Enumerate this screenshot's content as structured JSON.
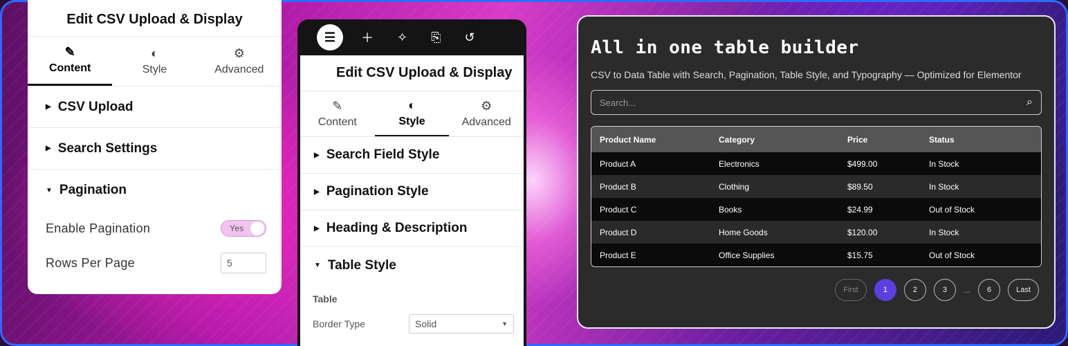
{
  "left_panel": {
    "title": "Edit CSV Upload & Display",
    "tabs": [
      {
        "label": "Content",
        "icon": "pencil-icon",
        "glyph": "✎"
      },
      {
        "label": "Style",
        "icon": "half-circle-icon",
        "glyph": "◐"
      },
      {
        "label": "Advanced",
        "icon": "gear-icon",
        "glyph": "⚙"
      }
    ],
    "sections": [
      "CSV Upload",
      "Search Settings",
      "Pagination"
    ],
    "enable_pagination_label": "Enable Pagination",
    "toggle_value": "Yes",
    "rows_per_page_label": "Rows Per Page",
    "rows_per_page_value": "5"
  },
  "middle_panel": {
    "title": "Edit CSV Upload & Display",
    "top_icons": [
      "elementor-logo-icon",
      "plus-icon",
      "sparkle-icon",
      "page-settings-icon",
      "history-icon"
    ],
    "tabs": [
      {
        "label": "Content",
        "icon": "pencil-icon",
        "glyph": "✎"
      },
      {
        "label": "Style",
        "icon": "half-circle-icon",
        "glyph": "◐"
      },
      {
        "label": "Advanced",
        "icon": "gear-icon",
        "glyph": "⚙"
      }
    ],
    "sections": [
      "Search Field Style",
      "Pagination Style",
      "Heading & Description",
      "Table Style"
    ],
    "sub_label": "Table",
    "border_type_label": "Border Type",
    "border_type_value": "Solid"
  },
  "right_panel": {
    "title": "All in one table builder",
    "description": "CSV to Data Table with Search, Pagination, Table Style, and Typography — Optimized for Elementor",
    "search_placeholder": "Search...",
    "table": {
      "headers": [
        "Product Name",
        "Category",
        "Price",
        "Status"
      ],
      "rows": [
        [
          "Product A",
          "Electronics",
          "$499.00",
          "In Stock"
        ],
        [
          "Product B",
          "Clothing",
          "$89.50",
          "In Stock"
        ],
        [
          "Product C",
          "Books",
          "$24.99",
          "Out of Stock"
        ],
        [
          "Product D",
          "Home Goods",
          "$120.00",
          "In Stock"
        ],
        [
          "Product E",
          "Office Supplies",
          "$15.75",
          "Out of Stock"
        ]
      ]
    },
    "pagination": {
      "first": "First",
      "pages": [
        "1",
        "2",
        "3"
      ],
      "ellipsis": "...",
      "last_page": "6",
      "last": "Last",
      "active_page": "1"
    },
    "accent_color": "#5b3fe0"
  }
}
